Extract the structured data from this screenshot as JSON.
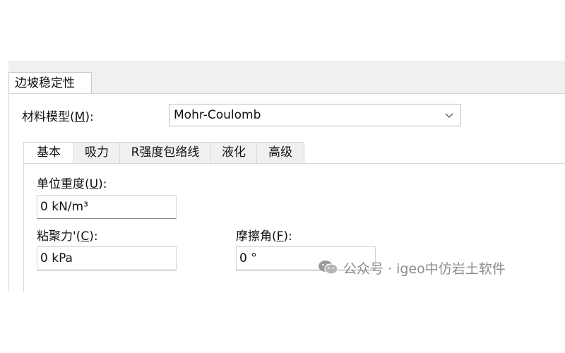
{
  "outer_tab": {
    "label": "边坡稳定性"
  },
  "material_model": {
    "label_prefix": "材料模型(",
    "label_key": "M",
    "label_suffix": "):",
    "value": "Mohr-Coulomb"
  },
  "inner_tabs": [
    {
      "label": "基本",
      "active": true
    },
    {
      "label": "吸力",
      "active": false
    },
    {
      "label": "R强度包络线",
      "active": false
    },
    {
      "label": "液化",
      "active": false
    },
    {
      "label": "高级",
      "active": false
    }
  ],
  "fields": {
    "unit_weight": {
      "label_prefix": "单位重度(",
      "label_key": "U",
      "label_suffix": "):",
      "value": "0 kN/m³"
    },
    "cohesion": {
      "label_prefix": "粘聚力'(",
      "label_key": "C",
      "label_suffix": "):",
      "value": "0 kPa"
    },
    "friction_angle": {
      "label_prefix": "摩擦角(",
      "label_key": "F",
      "label_suffix": "):",
      "value": "0 °"
    }
  },
  "watermark": {
    "text": "公众号 · igeo中仿岩土软件"
  },
  "colors": {
    "panel_bg": "#f0f0f0",
    "border": "#d6d6d6",
    "watermark": "#8c8c8c"
  }
}
